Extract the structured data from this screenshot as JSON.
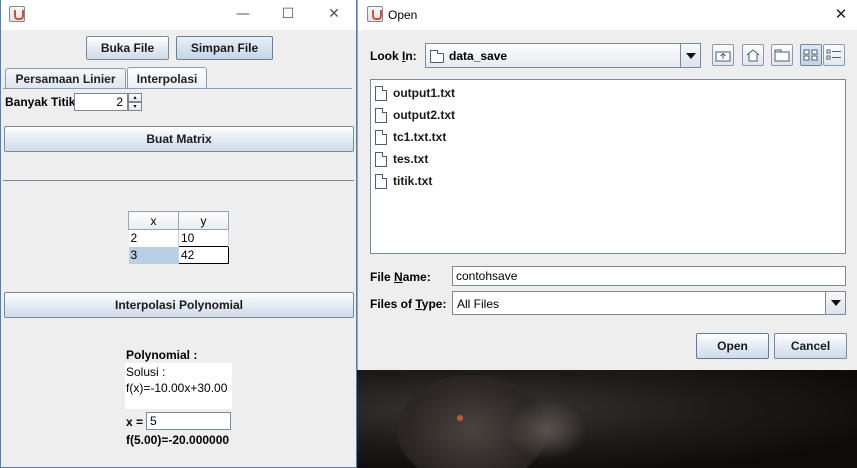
{
  "left_window": {
    "controls": {
      "minimize": "—",
      "maximize": "☐",
      "close": "✕"
    },
    "buttons": {
      "open_file": "Buka File",
      "save_file": "Simpan File",
      "build_matrix": "Buat Matrix",
      "interpolate": "Interpolasi Polynomial"
    },
    "tabs": [
      {
        "label": "Persamaan Linier"
      },
      {
        "label": "Interpolasi"
      }
    ],
    "points_label": "Banyak Titik",
    "points_value": "2",
    "table": {
      "headers": [
        "x",
        "y"
      ],
      "rows": [
        [
          "2",
          "10"
        ],
        [
          "3",
          "42"
        ]
      ]
    },
    "result": {
      "heading": "Polynomial :",
      "solution_label": "Solusi :",
      "formula": "f(x)=-10.00x+30.00",
      "x_label": "x =",
      "x_value": "5",
      "evaluation": "f(5.00)=-20.000000"
    }
  },
  "open_dialog": {
    "title": "Open",
    "close": "✕",
    "look_in_label_pre": "Look ",
    "look_in_label_u": "I",
    "look_in_label_post": "n:",
    "look_in_value": "data_save",
    "files": [
      "output1.txt",
      "output2.txt",
      "tc1.txt.txt",
      "tes.txt",
      "titik.txt"
    ],
    "file_name_label_pre": "File ",
    "file_name_label_u": "N",
    "file_name_label_post": "ame:",
    "file_name_value": "contohsave",
    "file_type_label_pre": "Files of ",
    "file_type_label_u": "T",
    "file_type_label_post": "ype:",
    "file_type_value": "All Files",
    "open_button": "Open",
    "cancel_button": "Cancel",
    "icons": [
      "up-folder-icon",
      "home-icon",
      "new-folder-icon",
      "list-view-icon",
      "details-view-icon"
    ]
  }
}
